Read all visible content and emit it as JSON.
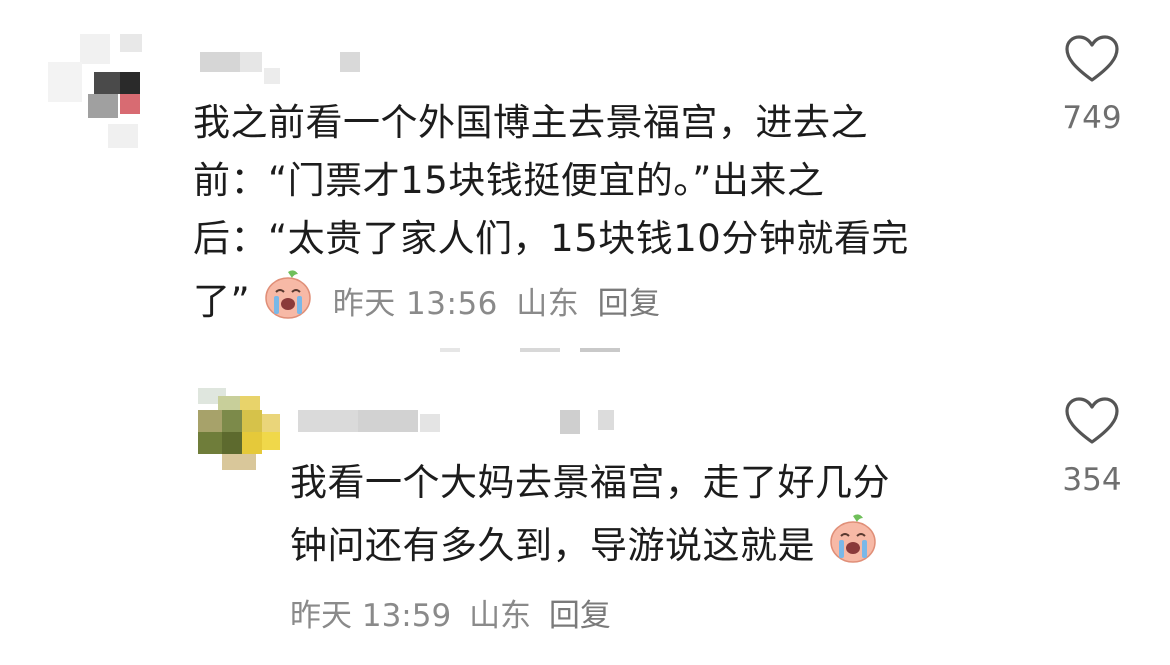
{
  "comments": [
    {
      "text_lines": [
        "我之前看一个外国博主去景福宫，进去之",
        "前：“门票才15块钱挺便宜的。”出来之",
        "后：“太贵了家人们，15块钱10分钟就看完",
        "了”"
      ],
      "emoji": "crying-face-emoji",
      "time": "昨天 13:56",
      "location": "山东",
      "reply_label": "回复",
      "likes": "749"
    },
    {
      "text_lines": [
        "我看一个大妈去景福宫，走了好几分",
        "钟问还有多久到，导游说这就是"
      ],
      "emoji": "crying-face-emoji",
      "time": "昨天 13:59",
      "location": "山东",
      "reply_label": "回复",
      "likes": "354"
    }
  ],
  "icons": {
    "like": "heart-outline-icon"
  },
  "colors": {
    "text": "#1c1c1c",
    "meta": "#8a8a8a",
    "heart_stroke": "#555555",
    "emoji_face": "#f7b9a6"
  }
}
